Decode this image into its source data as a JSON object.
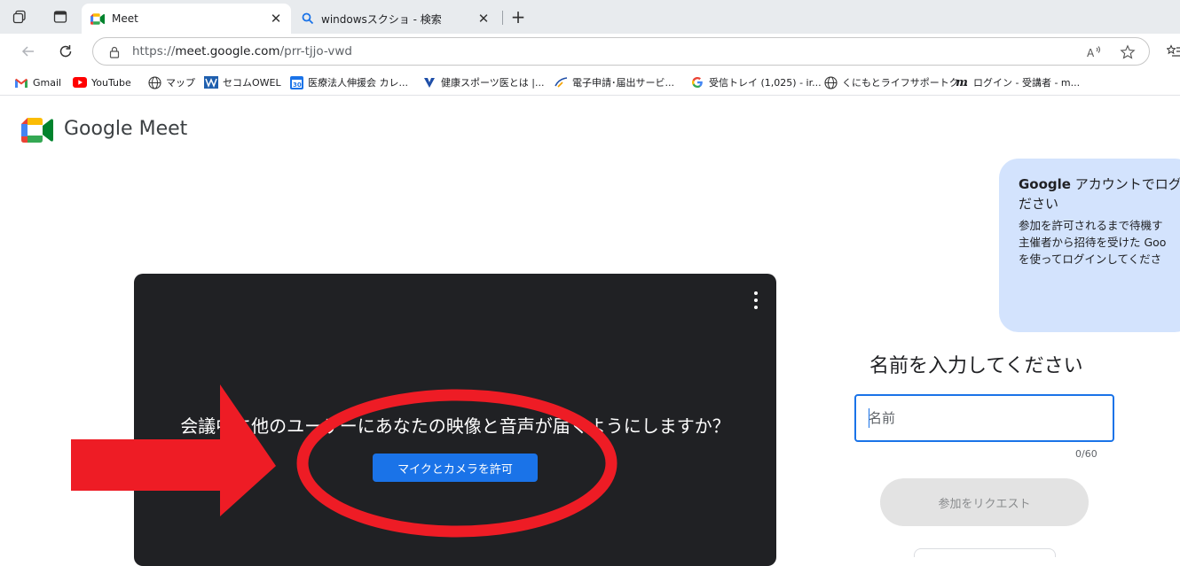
{
  "browser": {
    "tabs": [
      {
        "title": "Meet",
        "icon": "google-meet-icon",
        "active": true
      },
      {
        "title": "windowsスクショ - 検索",
        "icon": "search-icon",
        "active": false
      }
    ],
    "close_glyph": "✕",
    "new_tab_glyph": "+",
    "url_scheme": "https://",
    "url_host": "meet.google.com",
    "url_path": "/prr-tjjo-vwd",
    "bookmarks": [
      {
        "label": "Gmail",
        "icon": "gmail-icon"
      },
      {
        "label": "YouTube",
        "icon": "youtube-icon"
      },
      {
        "label": "マップ",
        "icon": "globe-icon"
      },
      {
        "label": "セコムOWEL",
        "icon": "secom-icon"
      },
      {
        "label": "医療法人伸援会 カレ...",
        "icon": "calendar-icon"
      },
      {
        "label": "健康スポーツ医とは |...",
        "icon": "sports-icon"
      },
      {
        "label": "電子申請･届出サービ...",
        "icon": "gov-icon"
      },
      {
        "label": "受信トレイ (1,025) - ir...",
        "icon": "google-icon"
      },
      {
        "label": "くにもとライフサポートク...",
        "icon": "globe-icon"
      },
      {
        "label": "ログイン - 受講者 - m...",
        "icon": "m-icon"
      }
    ]
  },
  "meet": {
    "brand_google": "Google",
    "brand_meet": "Meet",
    "permission_text": "会議中に他のユーザーにあなたの映像と音声が届くようにしますか？",
    "allow_button": "マイクとカメラを許可",
    "info_title_bold": "Google",
    "info_title_rest": " アカウントでログ",
    "info_title_line2": "ださい",
    "info_body": [
      "参加を許可されるまで待機す",
      "主催者から招待を受けた Goo",
      "を使ってログインしてくださ"
    ],
    "name_heading": "名前を入力してください",
    "name_placeholder": "名前",
    "name_value": "",
    "counter": "0/60",
    "join_button": "参加をリクエスト"
  },
  "colors": {
    "accent_blue": "#1a73e8",
    "annotation_red": "#ee1c25",
    "video_bg": "#202124",
    "info_card_bg": "#d3e3fd"
  }
}
